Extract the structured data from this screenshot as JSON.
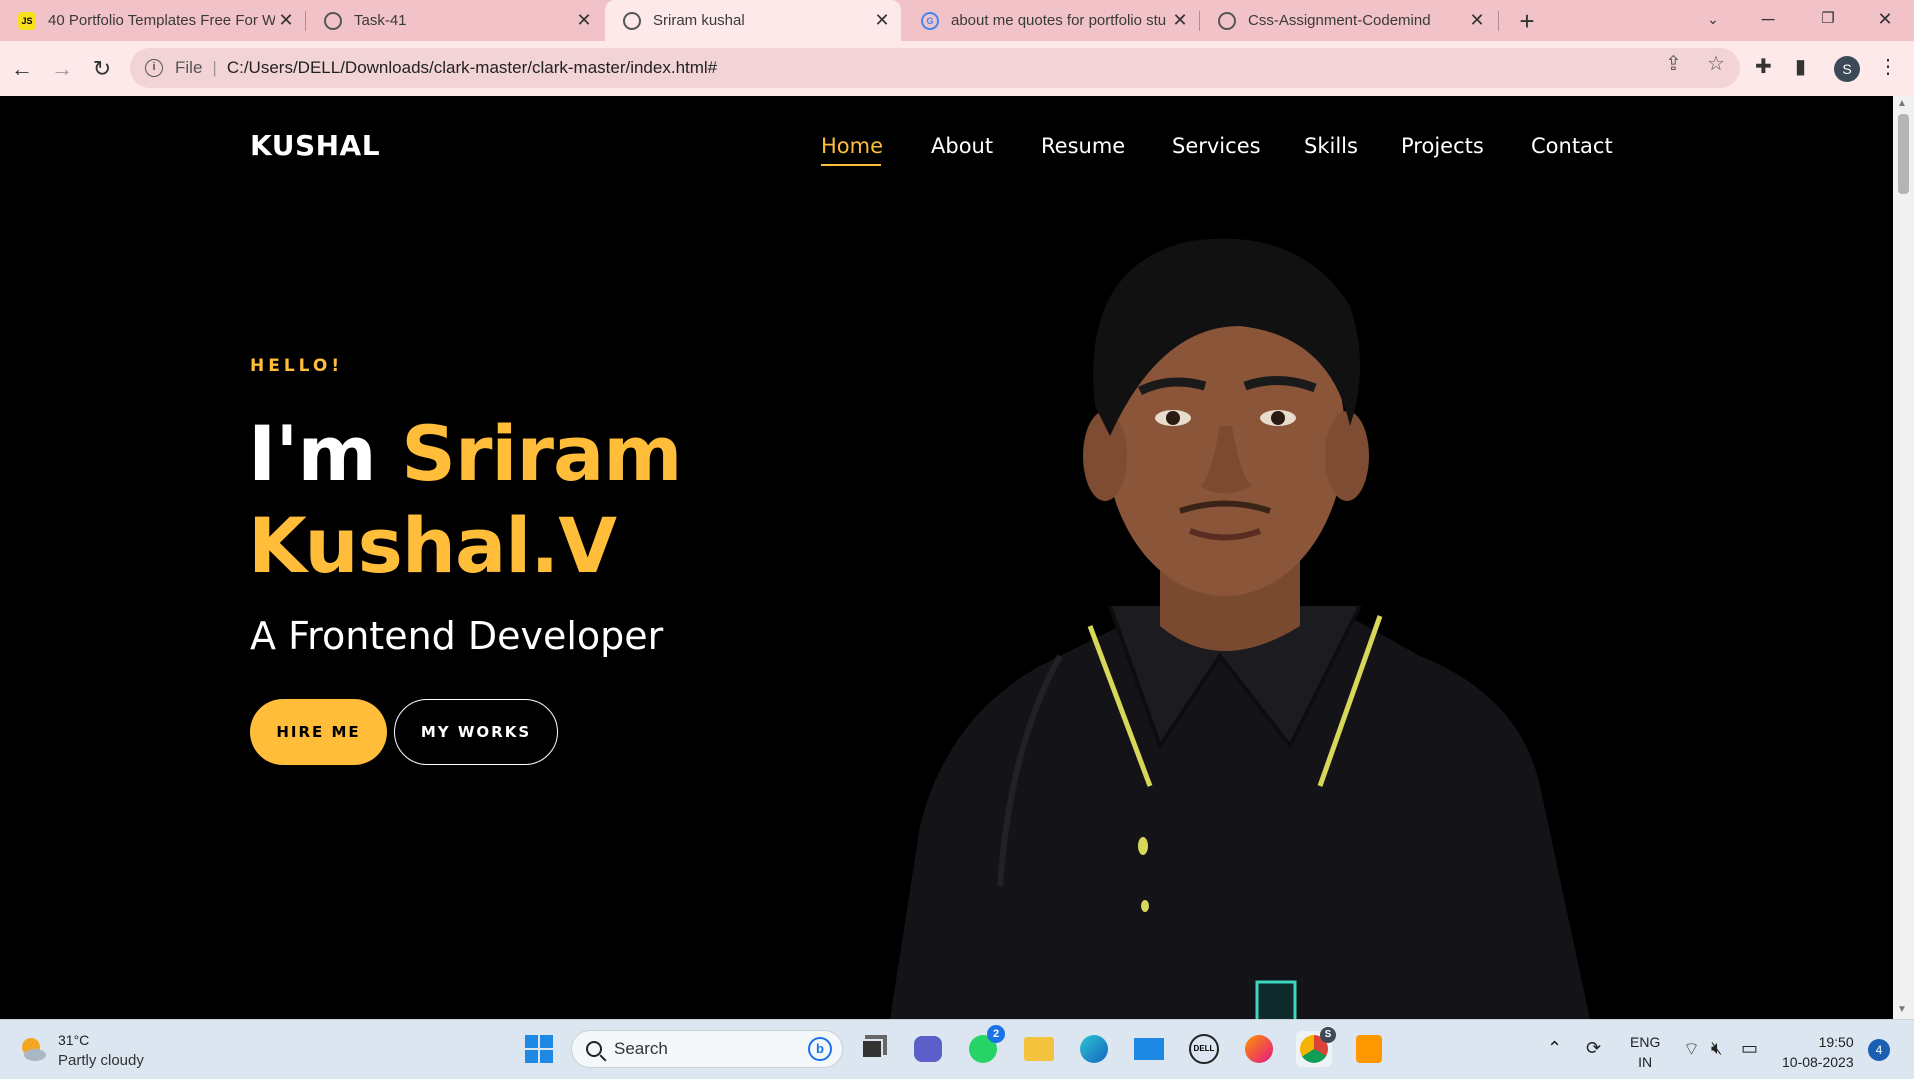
{
  "browser": {
    "tabs": [
      {
        "title": "40 Portfolio Templates Free For W",
        "favicon": "js-icon"
      },
      {
        "title": "Task-41",
        "favicon": "globe-icon"
      },
      {
        "title": "Sriram kushal",
        "favicon": "globe-icon"
      },
      {
        "title": "about me quotes for portfolio stu",
        "favicon": "google-icon"
      },
      {
        "title": "Css-Assignment-Codemind",
        "favicon": "globe-icon"
      }
    ],
    "address": {
      "scheme": "File",
      "url": "C:/Users/DELL/Downloads/clark-master/clark-master/index.html#"
    },
    "profile_initial": "S"
  },
  "site": {
    "logo": "KUSHAL",
    "nav": [
      "Home",
      "About",
      "Resume",
      "Services",
      "Skills",
      "Projects",
      "Contact"
    ],
    "active_nav": "Home",
    "hero": {
      "greeting": "HELLO!",
      "intro": "I'm",
      "name_line1": "Sriram",
      "name_line2": "Kushal.V",
      "role": "A Frontend Developer",
      "primary_button": "HIRE ME",
      "secondary_button": "MY WORKS"
    },
    "accent_color": "#ffbd39"
  },
  "taskbar": {
    "weather_temp": "31°C",
    "weather_desc": "Partly cloudy",
    "search_placeholder": "Search",
    "whatsapp_badge": "2",
    "chrome_badge": "S",
    "lang_line1": "ENG",
    "lang_line2": "IN",
    "time": "19:50",
    "date": "10-08-2023",
    "notification_count": "4"
  }
}
